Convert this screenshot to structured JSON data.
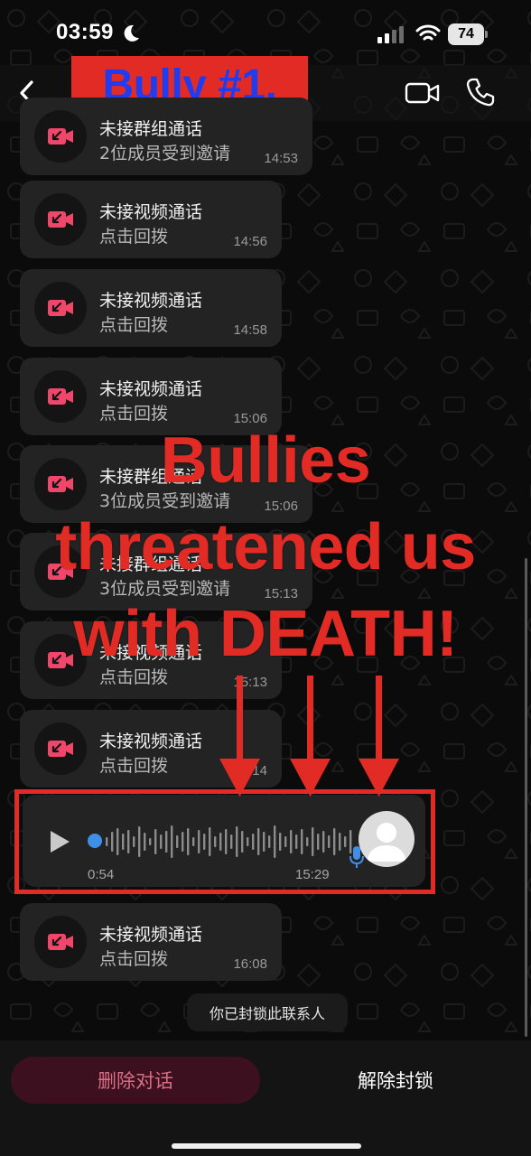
{
  "status_bar": {
    "time": "03:59",
    "battery": "74"
  },
  "header": {
    "title": "Bully #1."
  },
  "overlay": {
    "line1": "Bullies",
    "line2": "threatened us",
    "line3": "with DEATH!"
  },
  "messages": [
    {
      "title": "未接群组通话",
      "subtitle": "2位成员受到邀请",
      "time": "14:53"
    },
    {
      "title": "未接视频通话",
      "subtitle": "点击回拨",
      "time": "14:56"
    },
    {
      "title": "未接视频通话",
      "subtitle": "点击回拨",
      "time": "14:58"
    },
    {
      "title": "未接视频通话",
      "subtitle": "点击回拨",
      "time": "15:06"
    },
    {
      "title": "未接群组通话",
      "subtitle": "3位成员受到邀请",
      "time": "15:06"
    },
    {
      "title": "未接群组通话",
      "subtitle": "3位成员受到邀请",
      "time": "15:13"
    },
    {
      "title": "未接视频通话",
      "subtitle": "点击回拨",
      "time": "15:13"
    },
    {
      "title": "未接视频通话",
      "subtitle": "点击回拨",
      "time": "15:14"
    },
    {
      "title": "未接视频通话",
      "subtitle": "点击回拨",
      "time": "16:08"
    }
  ],
  "voice_message": {
    "duration": "0:54",
    "time": "15:29"
  },
  "system_notice": "你已封锁此联系人",
  "bottom_bar": {
    "delete_label": "删除对话",
    "unblock_label": "解除封锁"
  },
  "colors": {
    "annotation_red": "#e32b26",
    "title_blue": "#1f3cf0",
    "missed_call_pink": "#f0466a",
    "voice_progress_blue": "#3f8fe8"
  },
  "icons": [
    "back-arrow-icon",
    "video-camera-icon",
    "phone-icon",
    "missed-video-call-icon",
    "play-icon",
    "microphone-icon",
    "avatar-placeholder-icon",
    "moon-icon",
    "signal-icon",
    "wifi-icon",
    "battery-icon"
  ]
}
